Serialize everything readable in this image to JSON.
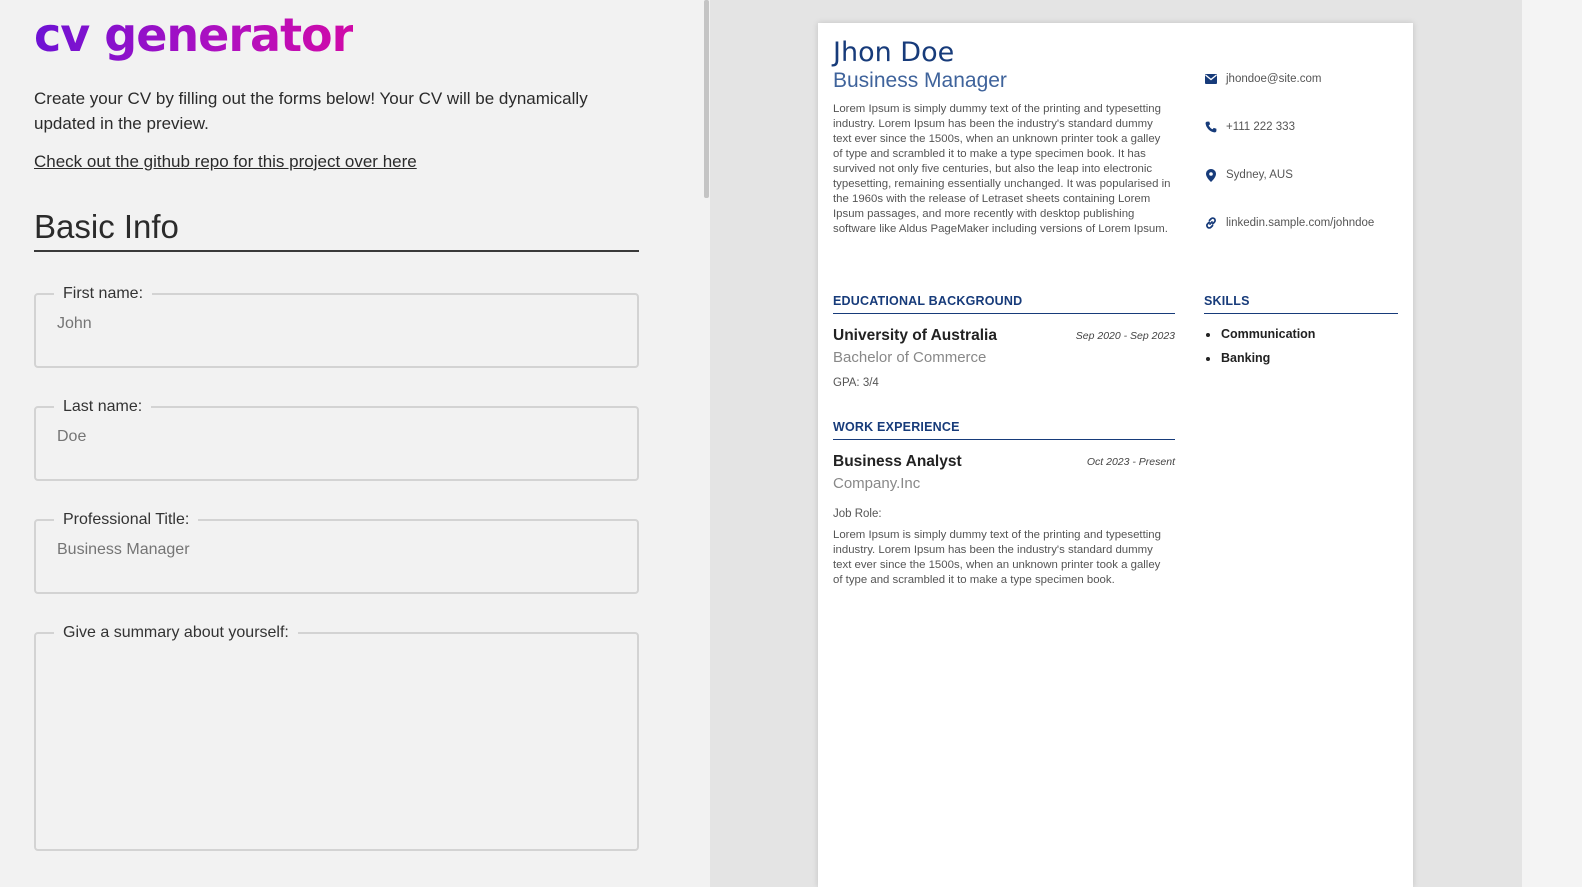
{
  "app": {
    "logo": "cv generator",
    "intro": "Create your CV by filling out the forms below! Your CV will be dynamically updated in the preview.",
    "repo_link": "Check out the github repo for this project over here"
  },
  "form": {
    "section_title": "Basic Info",
    "first_name": {
      "label": "First name:",
      "placeholder": "John"
    },
    "last_name": {
      "label": "Last name:",
      "placeholder": "Doe"
    },
    "professional_title": {
      "label": "Professional Title:",
      "placeholder": "Business Manager"
    },
    "summary": {
      "label": "Give a summary about yourself:",
      "placeholder": ""
    }
  },
  "cv": {
    "name": "Jhon Doe",
    "title": "Business Manager",
    "summary": "Lorem Ipsum is simply dummy text of the printing and typesetting industry. Lorem Ipsum has been the industry's standard dummy text ever since the 1500s, when an unknown printer took a galley of type and scrambled it to make a type specimen book. It has survived not only five centuries, but also the leap into electronic typesetting, remaining essentially unchanged. It was popularised in the 1960s with the release of Letraset sheets containing Lorem Ipsum passages, and more recently with desktop publishing software like Aldus PageMaker including versions of Lorem Ipsum.",
    "contact": {
      "email": "jhondoe@site.com",
      "phone": "+111 222 333",
      "location": "Sydney, AUS",
      "linkedin": "linkedin.sample.com/johndoe"
    },
    "education": {
      "heading": "EDUCATIONAL BACKGROUND",
      "school": "University of Australia",
      "degree": "Bachelor of Commerce",
      "dates": "Sep 2020 - Sep 2023",
      "gpa": "GPA: 3/4"
    },
    "work": {
      "heading": "WORK EXPERIENCE",
      "position": "Business Analyst",
      "company": "Company.Inc",
      "dates": "Oct 2023 - Present",
      "role_label": "Job Role:",
      "description": "Lorem Ipsum is simply dummy text of the printing and typesetting industry. Lorem Ipsum has been the industry's standard dummy text ever since the 1500s, when an unknown printer took a galley of type and scrambled it to make a type specimen book."
    },
    "skills": {
      "heading": "SKILLS",
      "items": [
        "Communication",
        "Banking"
      ]
    }
  },
  "colors": {
    "accent_navy": "#173b7a",
    "logo_gradient_start": "#6d12d4",
    "logo_gradient_end": "#d00aa8"
  },
  "icons": [
    "envelope-icon",
    "phone-icon",
    "map-pin-icon",
    "link-icon"
  ]
}
